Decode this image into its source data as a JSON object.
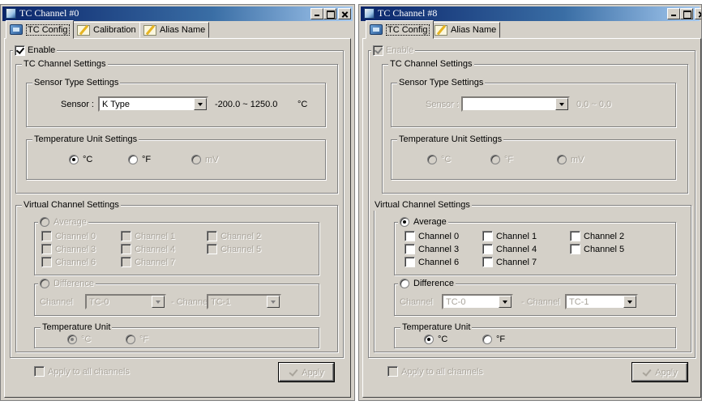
{
  "windows": [
    {
      "title": "TC Channel #0",
      "tabs": [
        "TC Config",
        "Calibration",
        "Alias Name"
      ],
      "enable_label": "Enable",
      "tc_channel_settings": {
        "legend": "TC Channel Settings",
        "sensor_type": {
          "legend": "Sensor Type Settings",
          "label": "Sensor :",
          "value": "K Type",
          "range": "-200.0 ~ 1250.0",
          "unit": "°C"
        },
        "temperature_unit": {
          "legend": "Temperature Unit Settings",
          "options": [
            "°C",
            "°F",
            "mV"
          ]
        }
      },
      "virtual_channel_settings": {
        "legend": "Virtual Channel Settings",
        "average_label": "Average",
        "channels": [
          "Channel 0",
          "Channel 1",
          "Channel 2",
          "Channel 3",
          "Channel 4",
          "Channel 5",
          "Channel 6",
          "Channel 7"
        ],
        "difference_label": "Difference",
        "channel_label": "Channel",
        "diff_a": "TC-0",
        "minus_channel_label": "- Channel",
        "diff_b": "TC-1",
        "temperature_unit_legend": "Temperature Unit",
        "unit_options": [
          "°C",
          "°F"
        ]
      },
      "apply_all_label": "Apply to all channels",
      "apply_label": "Apply"
    },
    {
      "title": "TC Channel #8",
      "tabs": [
        "TC Config",
        "Alias Name"
      ],
      "enable_label": "Enable",
      "tc_channel_settings": {
        "legend": "TC Channel Settings",
        "sensor_type": {
          "legend": "Sensor Type Settings",
          "label": "Sensor :",
          "value": "",
          "range": "0.0 ~ 0.0",
          "unit": ""
        },
        "temperature_unit": {
          "legend": "Temperature Unit Settings",
          "options": [
            "°C",
            "°F",
            "mV"
          ]
        }
      },
      "virtual_channel_settings": {
        "legend": "Virtual Channel Settings",
        "average_label": "Average",
        "channels": [
          "Channel 0",
          "Channel 1",
          "Channel 2",
          "Channel 3",
          "Channel 4",
          "Channel 5",
          "Channel 6",
          "Channel 7"
        ],
        "difference_label": "Difference",
        "channel_label": "Channel",
        "diff_a": "TC-0",
        "minus_channel_label": "- Channel",
        "diff_b": "TC-1",
        "temperature_unit_legend": "Temperature Unit",
        "unit_options": [
          "°C",
          "°F"
        ]
      },
      "apply_all_label": "Apply to all channels",
      "apply_label": "Apply"
    }
  ]
}
